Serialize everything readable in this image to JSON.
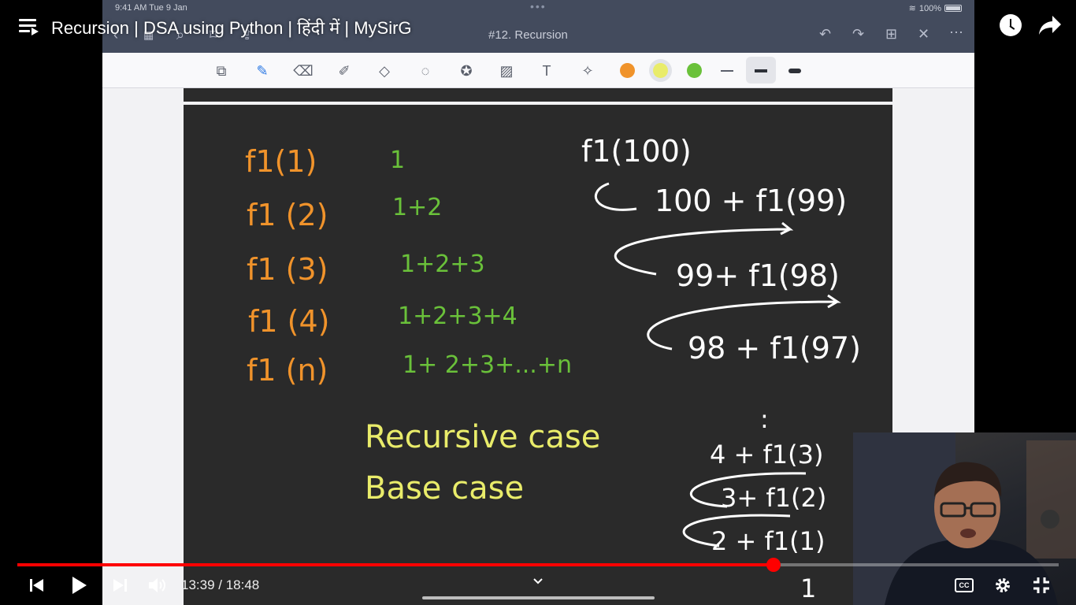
{
  "youtube": {
    "video_title": "Recursion | DSA using Python | हिंदी में | MySirG",
    "current_time": "13:39",
    "duration": "18:48",
    "time_separator": " / ",
    "progress": 0.7262,
    "cc_label": "CC"
  },
  "ipad": {
    "status_time": "9:41 AM  Tue 9 Jan",
    "battery": "100%",
    "note_title": "#12. Recursion",
    "ink_colors": [
      "#f0932b",
      "#e9ec6a",
      "#6ac13a"
    ]
  },
  "notes": {
    "left_fn": [
      "f1(1)",
      "f1 (2)",
      "f1 (3)",
      "f1 (4)",
      "f1 (n)"
    ],
    "left_sum": [
      "1",
      "1+2",
      "1+2+3",
      "1+2+3+4",
      "1+ 2+3+...+n"
    ],
    "top_right": [
      "f1(100)",
      "100 + f1(99)",
      "99+ f1(98)",
      "98 + f1(97)"
    ],
    "cases": [
      "Recursive case",
      "Base case"
    ],
    "bottom_right": [
      ":",
      "4 + f1(3)",
      "3+ f1(2)",
      "2 + f1(1)",
      "1"
    ],
    "colors": {
      "orange": "#f0932b",
      "green": "#6ac13a",
      "yellow": "#e9ec6a"
    }
  }
}
